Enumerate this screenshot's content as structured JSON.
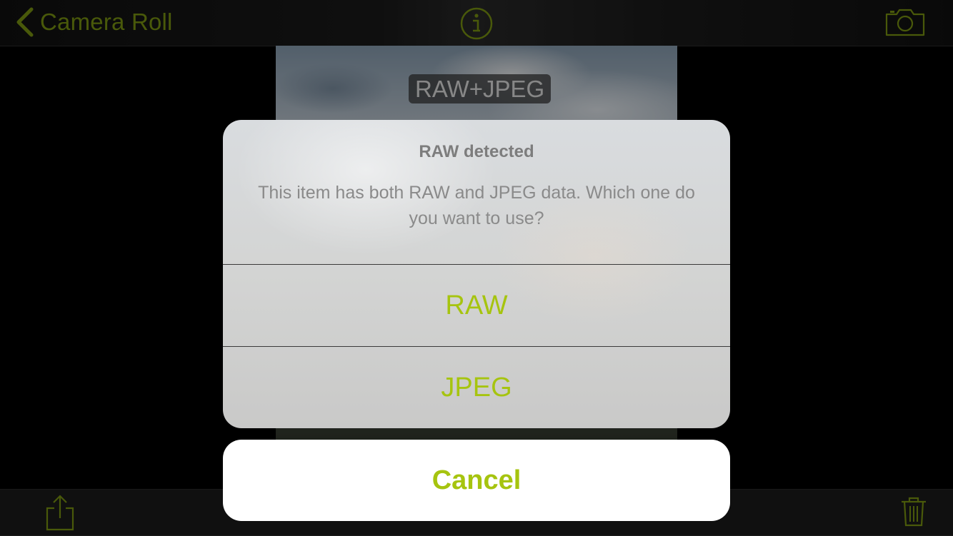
{
  "nav": {
    "back_label": "Camera Roll",
    "accent_color": "#7f9a12"
  },
  "photo": {
    "format_badge": "RAW+JPEG"
  },
  "toolbar": {
    "icons": [
      "share-icon",
      "trash-icon"
    ]
  },
  "dialog": {
    "title": "RAW detected",
    "message": "This item has both RAW and JPEG data. Which one do you want to use?",
    "options": [
      "RAW",
      "JPEG"
    ],
    "cancel_label": "Cancel",
    "option_color": "#a6c40f"
  }
}
